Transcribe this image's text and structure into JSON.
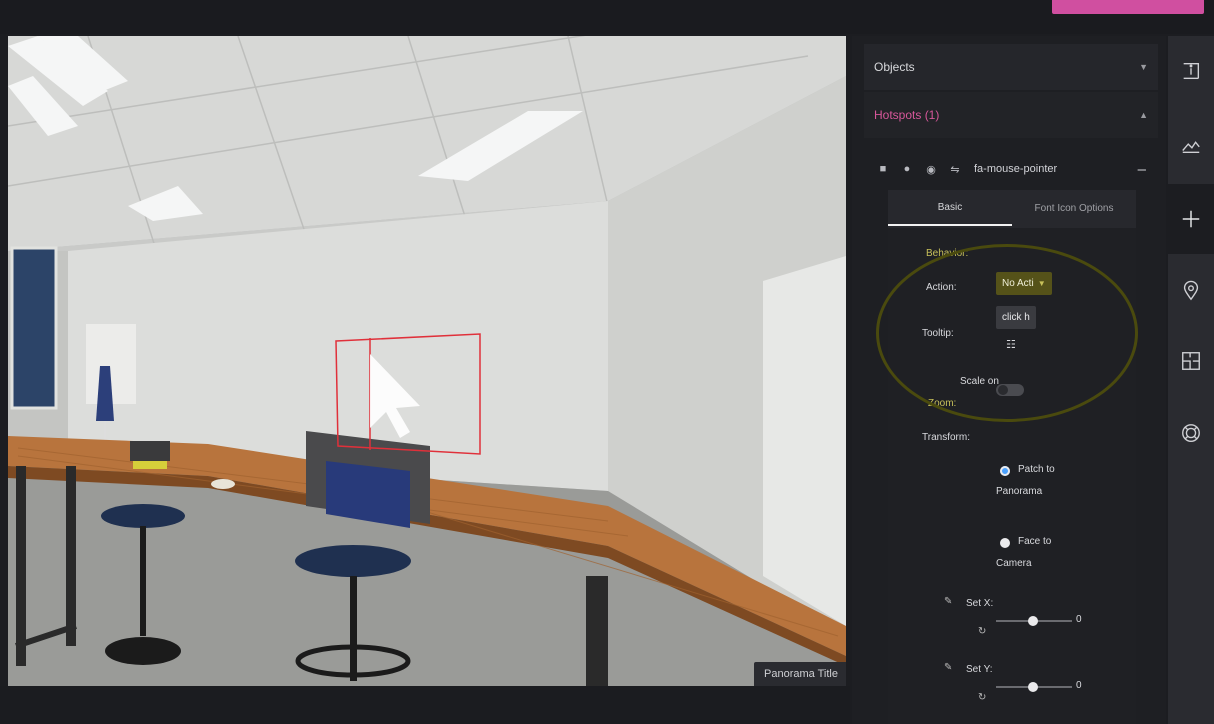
{
  "viewport": {
    "panorama_title": "Panorama Title"
  },
  "panel": {
    "objects_header": "Objects",
    "hotspots_header": "Hotspots (1)",
    "hotspot_row": {
      "icons": [
        "trash-icon",
        "copy-icon",
        "eye-icon",
        "link-icon"
      ],
      "name": "fa-mouse-pointer"
    },
    "tabs": [
      "Basic",
      "Font Icon Options"
    ],
    "behavior_label": "Behavior:",
    "action_label": "Action:",
    "action_value": "No Acti",
    "tooltip_label": "Tooltip:",
    "tooltip_value": "click h",
    "scale_label_1": "Scale on",
    "scale_label_2": "Zoom:",
    "transform_label": "Transform:",
    "option_patch_1": "Patch to",
    "option_patch_2": "Panorama",
    "option_face_1": "Face to",
    "option_face_2": "Camera",
    "setx_label": "Set X:",
    "setx_value": "0",
    "sety_label": "Set Y:",
    "sety_value": "0"
  },
  "rail": {
    "icons": [
      "info-icon",
      "image-icon",
      "plus-icon",
      "location-pin-icon",
      "floorplan-icon",
      "lifebuoy-icon"
    ]
  },
  "colors": {
    "accent_pink": "#d04fa0",
    "hotspots_pink": "#d7579a",
    "highlight_yellow": "#4a4a0e"
  }
}
